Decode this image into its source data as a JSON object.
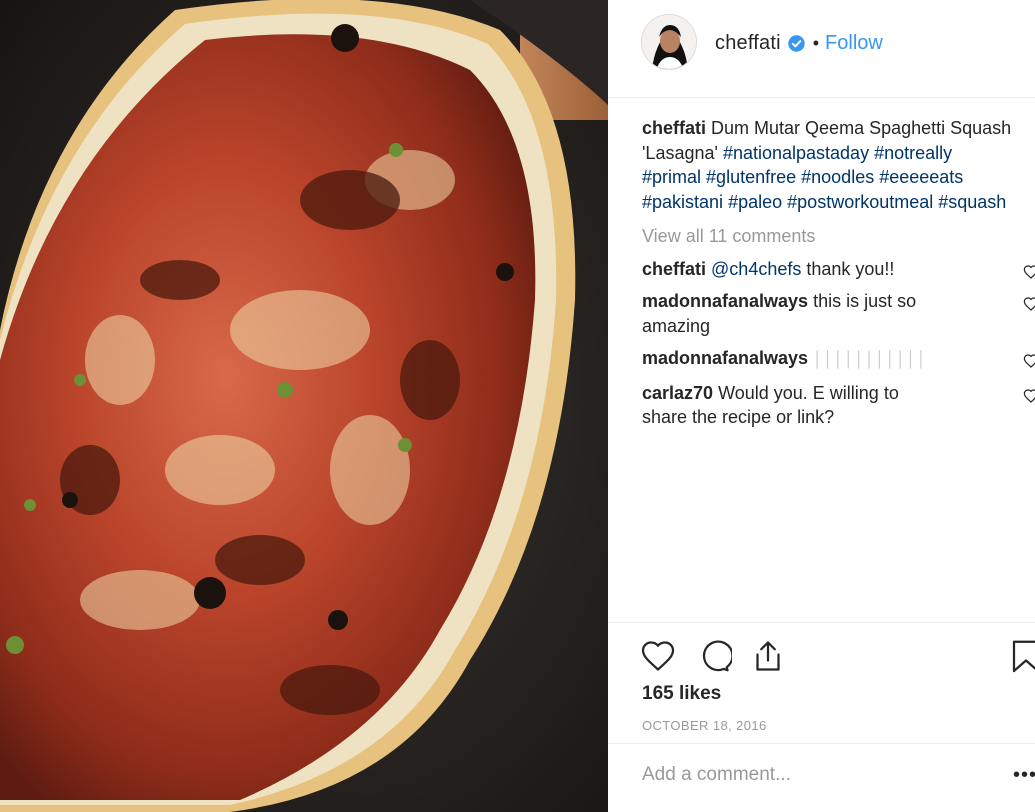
{
  "post": {
    "username": "cheffati",
    "follow_label": "Follow",
    "separator": "•",
    "verified_icon": "verified-badge-icon",
    "caption": {
      "username": "cheffati",
      "text_1": "Dum Mutar Qeema Spaghetti Squash",
      "text_2": "'Lasagna'",
      "line2_tags": [
        "#nationalpastaday",
        "#notreally"
      ],
      "line3_tags": [
        "#primal",
        "#glutenfree",
        "#noodles",
        "#eeeeeats"
      ],
      "line4_tags": [
        "#pakistani",
        "#paleo",
        "#postworkoutmeal",
        "#squash"
      ]
    },
    "view_all": "View all 11 comments",
    "comments": [
      {
        "username": "cheffati",
        "mention": "@ch4chefs",
        "text": "thank you!!"
      },
      {
        "username": "madonnafanalways",
        "text": "this is just so amazing"
      },
      {
        "username": "madonnafanalways",
        "text": "│││││││││││"
      },
      {
        "username": "carlaz70",
        "text": "Would you. E willing to share the recipe or link?"
      }
    ],
    "likes": "165 likes",
    "date": "OCTOBER 18, 2016",
    "add_comment_placeholder": "Add a comment...",
    "more_label": "•••",
    "icons": {
      "like": "heart-icon",
      "comment": "comment-icon",
      "share": "share-icon",
      "save": "bookmark-icon"
    }
  },
  "colors": {
    "link_blue": "#3897f0",
    "hashtag": "#003569",
    "muted": "#999999",
    "text": "#262626"
  }
}
